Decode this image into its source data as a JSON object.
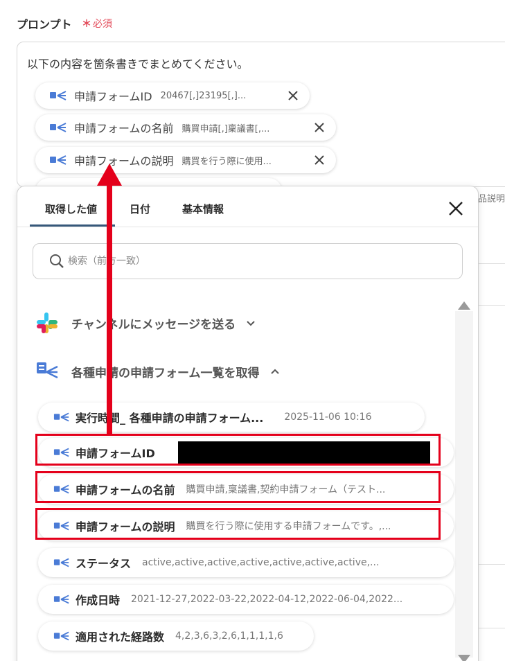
{
  "field": {
    "label": "プロンプト",
    "required_star": "＊",
    "required_text": "必須"
  },
  "prompt": {
    "text": "以下の内容を箇条書きでまとめてください。",
    "chips": [
      {
        "name": "申請フォームID",
        "value": "20467[,]23195[,]..."
      },
      {
        "name": "申請フォームの名前",
        "value": "購買申請[,]稟議書[,..."
      },
      {
        "name": "申請フォームの説明",
        "value": "購買を行う際に使用..."
      }
    ]
  },
  "side_text": "品説明",
  "popup": {
    "tabs": [
      "取得した値",
      "日付",
      "基本情報"
    ],
    "active_tab": "取得した値",
    "search_placeholder": "検索（前方一致）",
    "sections": [
      {
        "title": "チャンネルにメッセージを送る",
        "expanded": false,
        "icon": "slack-icon"
      },
      {
        "title": "各種申請の申請フォーム一覧を取得",
        "expanded": true,
        "icon": "form-app-icon"
      }
    ],
    "items": [
      {
        "name": "実行時間_ 各種申請の申請フォーム...",
        "value": "2025-11-06 10:16"
      },
      {
        "name": "申請フォームID",
        "value": ""
      },
      {
        "name": "申請フォームの名前",
        "value": "購買申請,稟議書,契約申請フォーム（テスト..."
      },
      {
        "name": "申請フォームの説明",
        "value": "購買を行う際に使用する申請フォームです。,..."
      },
      {
        "name": "ステータス",
        "value": "active,active,active,active,active,active,active,..."
      },
      {
        "name": "作成日時",
        "value": "2021-12-27,2022-03-22,2022-04-12,2022-06-04,2022..."
      },
      {
        "name": "適用された経路数",
        "value": "4,2,3,6,3,2,6,1,1,1,1,6"
      }
    ]
  },
  "colors": {
    "accent": "#36587a",
    "required": "#e34b5a",
    "annotation": "#e4001b",
    "form_icon": "#4a7bd6"
  }
}
